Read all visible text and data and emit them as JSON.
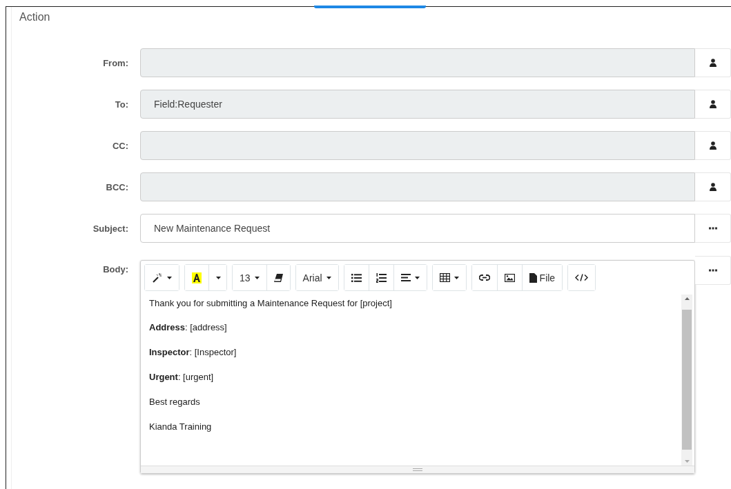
{
  "panel": {
    "title": "Action"
  },
  "fields": [
    {
      "label": "From:",
      "disabled": true,
      "kind": "recipient"
    },
    {
      "label": "To:",
      "value": "Field:Requester",
      "disabled": true,
      "kind": "recipient"
    },
    {
      "label": "CC:",
      "disabled": true,
      "kind": "recipient"
    },
    {
      "label": "BCC:",
      "disabled": true,
      "kind": "recipient"
    },
    {
      "label": "Subject:",
      "value": "New Maintenance Request",
      "disabled": false,
      "kind": "text"
    }
  ],
  "body": {
    "label": "Body:",
    "toolbar": [
      [
        {
          "kind": "magic",
          "dropdown": true
        }
      ],
      [
        {
          "kind": "highlight"
        },
        {
          "kind": "caret",
          "dropdown": true
        }
      ],
      [
        {
          "kind": "text",
          "label": "13",
          "dropdown": true
        },
        {
          "kind": "eraser"
        }
      ],
      [
        {
          "kind": "text",
          "label": "Arial",
          "dropdown": true
        }
      ],
      [
        {
          "kind": "bullets"
        },
        {
          "kind": "numbers"
        },
        {
          "kind": "align",
          "dropdown": true
        }
      ],
      [
        {
          "kind": "table",
          "dropdown": true
        }
      ],
      [
        {
          "kind": "link"
        },
        {
          "kind": "image"
        },
        {
          "kind": "file",
          "label": "File"
        }
      ],
      [
        {
          "kind": "code"
        }
      ]
    ],
    "paragraphs": [
      "Thank you for submitting a Maintenance Request for [project]",
      "**Address**: [address]",
      "**Inspector**: [Inspector]",
      "**Urgent**: [urgent]",
      "Best regards",
      "Kianda Training"
    ]
  }
}
